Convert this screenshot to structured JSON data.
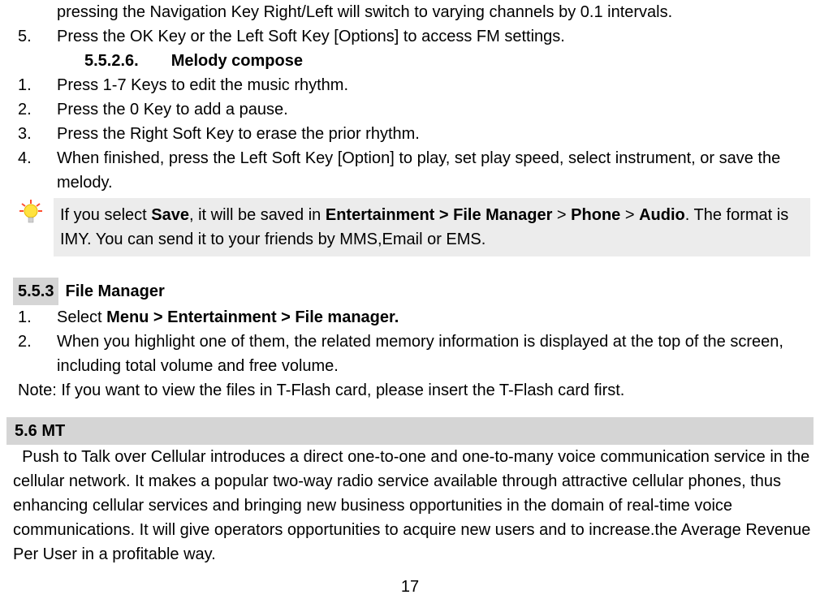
{
  "intro_line": "pressing the Navigation Key Right/Left will switch to varying channels by 0.1 intervals.",
  "fm_item5_num": "5.",
  "fm_item5_text": "Press the OK Key or the Left Soft Key [Options] to access FM settings.",
  "subheading_num": "5.5.2.6.",
  "subheading_title": "Melody compose",
  "mc": {
    "i1_num": "1.",
    "i1_text": "Press 1-7 Keys to edit the music rhythm.",
    "i2_num": "2.",
    "i2_text": "Press the 0 Key to add a pause.",
    "i3_num": "3.",
    "i3_text": "Press the Right Soft Key to erase the prior rhythm.",
    "i4_num": "4.",
    "i4_text": "When finished, press the Left Soft Key [Option] to play, set play speed, select instrument, or save the melody."
  },
  "tip": {
    "pre": "If you select ",
    "b_save": "Save",
    "mid1": ", it will be saved in ",
    "b_path1": "Entertainment > File Manager",
    "mid2": " > ",
    "b_phone": "Phone",
    "mid3": " > ",
    "b_audio": "Audio",
    "tail": ". The format is IMY. You can send it to your friends by MMS,Email or EMS."
  },
  "sec553_num": "5.5.3",
  "sec553_title": "File Manager",
  "fm": {
    "i1_num": "1.",
    "i1_pre": "Select ",
    "i1_bold": "Menu > Entertainment > File manager.",
    "i2_num": "2.",
    "i2_text": "When you highlight one of them, the related memory information is displayed at the top of the screen, including total volume and free volume."
  },
  "note_text": "Note: If you want to view the files in T-Flash card, please insert the T-Flash card first.",
  "sec56_title": "5.6 MT",
  "sec56_body": "  Push to Talk over Cellular introduces a direct one-to-one and one-to-many voice communication service in the cellular network. It makes a popular two-way radio service available through attractive cellular phones, thus enhancing cellular services and bringing new business opportunities in the domain of real-time voice communications. It will give operators opportunities to acquire new users and to increase.the Average Revenue Per User in a profitable way.",
  "page_number": "17"
}
